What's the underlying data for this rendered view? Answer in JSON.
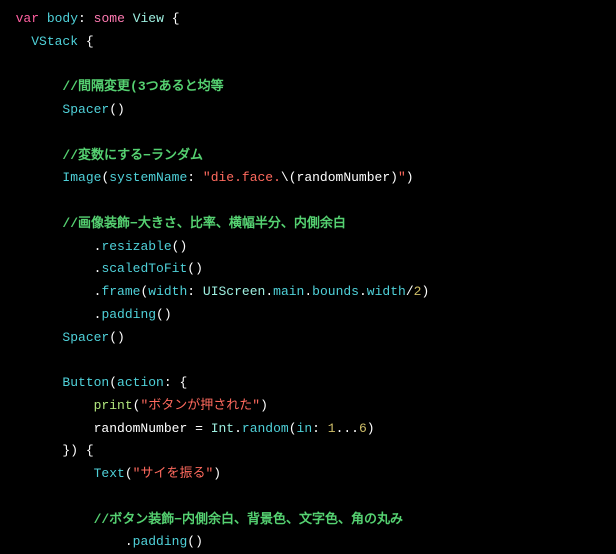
{
  "code": {
    "kw_var": "var",
    "ident_body": "body",
    "colon": ":",
    "kw_some": "some",
    "type_View": "View",
    "brace_open": "{",
    "brace_close": "}",
    "paren_open": "(",
    "paren_close": ")",
    "dot": ".",
    "eq": "=",
    "slash2": "//",
    "VStack": "VStack",
    "Spacer": "Spacer",
    "Image": "Image",
    "Button": "Button",
    "Text": "Text",
    "systemName": "systemName",
    "width_param": "width",
    "action": "action",
    "in_param": "in",
    "resizable": "resizable",
    "scaledToFit": "scaledToFit",
    "frame": "frame",
    "padding": "padding",
    "UIScreen": "UIScreen",
    "main": "main",
    "bounds": "bounds",
    "width_prop": "width",
    "Int": "Int",
    "random": "random",
    "print": "print",
    "randomNumber": "randomNumber",
    "comment1": "間隔変更(3つあると均等",
    "comment2": "変数にする−ランダム",
    "comment3": "画像装飾−大きさ、比率、横幅半分、内側余白",
    "comment4": "ボタン装飾−内側余白、背景色、文字色、角の丸み",
    "str_die_prefix": "\"die.face.",
    "str_die_interp_open": "\\(",
    "str_die_interp_close": ")",
    "str_die_suffix": "\"",
    "str_button_pressed": "\"ボタンが押された\"",
    "str_roll_dice": "\"サイを振る\"",
    "num_2": "2",
    "num_1": "1",
    "num_6": "6",
    "dots3": "...",
    "close_paren_brace": "}) {"
  }
}
